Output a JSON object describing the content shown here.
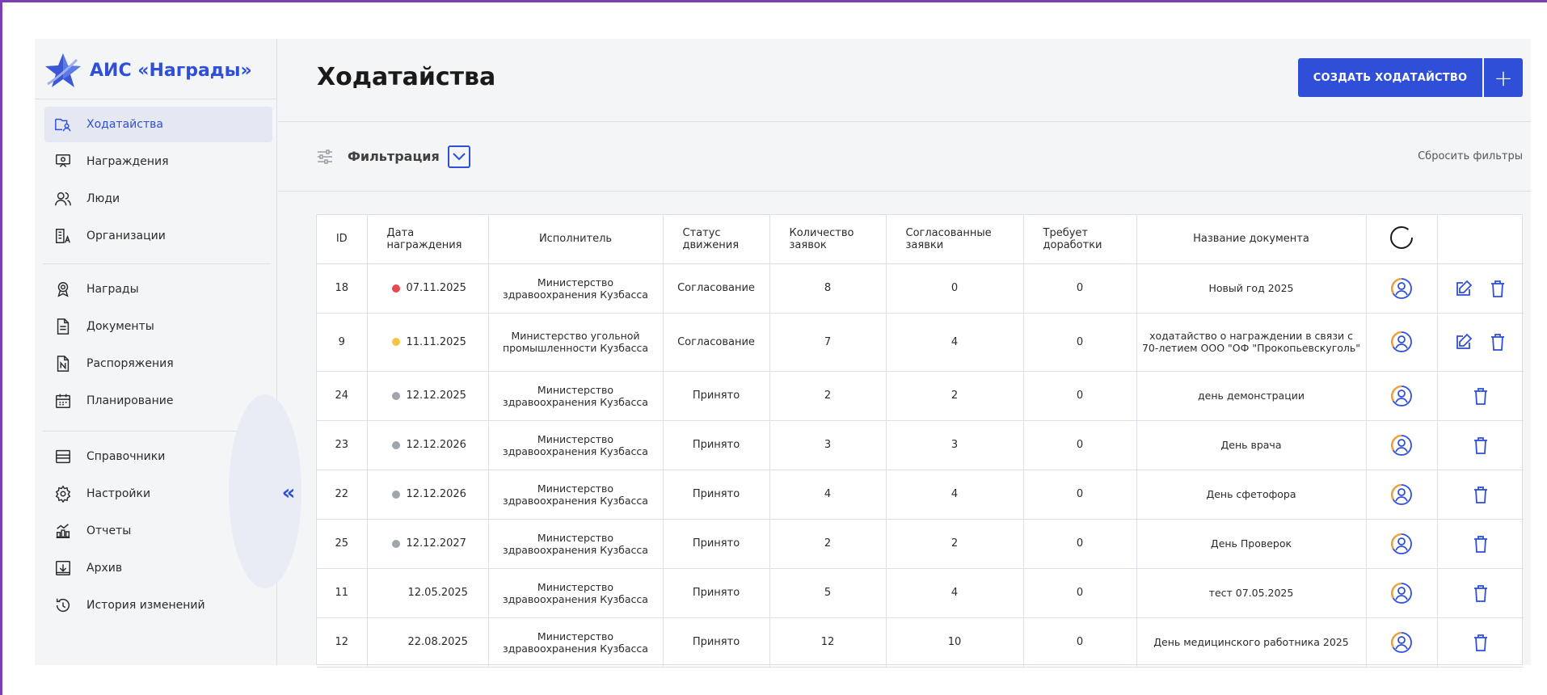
{
  "app": {
    "title": "АИС «Награды»"
  },
  "sidebar": {
    "items": [
      {
        "label": "Ходатайства",
        "icon": "folder-user-icon",
        "active": true
      },
      {
        "label": "Награждения",
        "icon": "presentation-icon"
      },
      {
        "label": "Люди",
        "icon": "users-icon"
      },
      {
        "label": "Организации",
        "icon": "organization-icon"
      },
      {
        "label": "Награды",
        "icon": "medal-icon"
      },
      {
        "label": "Документы",
        "icon": "document-icon"
      },
      {
        "label": "Распоряжения",
        "icon": "order-document-icon"
      },
      {
        "label": "Планирование",
        "icon": "calendar-icon"
      },
      {
        "label": "Справочники",
        "icon": "reference-icon"
      },
      {
        "label": "Настройки",
        "icon": "gear-icon"
      },
      {
        "label": "Отчеты",
        "icon": "reports-icon"
      },
      {
        "label": "Архив",
        "icon": "archive-icon"
      },
      {
        "label": "История изменений",
        "icon": "history-icon"
      }
    ],
    "collapse_label": "«"
  },
  "header": {
    "title": "Ходатайства",
    "create_label": "СОЗДАТЬ ХОДАТАЙСТВО",
    "plus_label": "+"
  },
  "filters": {
    "label": "Фильтрация",
    "reset_label": "Сбросить фильтры"
  },
  "colors": {
    "accent": "#2f4fd8",
    "status_red": "#e5484d",
    "status_yellow": "#f5c542",
    "status_gray": "#a0a4ab"
  },
  "table": {
    "headers": {
      "id": "ID",
      "date": "Дата награждения",
      "executor": "Исполнитель",
      "status": "Статус движения",
      "count": "Количество заявок",
      "agreed": "Согласованные заявки",
      "rework": "Требует доработки",
      "doc": "Название документа"
    },
    "rows": [
      {
        "id": "18",
        "dot": "red",
        "date": "07.11.2025",
        "executor": "Министерство здравоохранения Кузбасса",
        "status": "Согласование",
        "count": "8",
        "agreed": "0",
        "rework": "0",
        "doc": "Новый год 2025",
        "editable": true
      },
      {
        "id": "9",
        "dot": "yellow",
        "date": "11.11.2025",
        "executor": "Министерство угольной промышленности Кузбасса",
        "status": "Согласование",
        "count": "7",
        "agreed": "4",
        "rework": "0",
        "doc": "ходатайство о награждении в связи с 70-летием ООО \"ОФ \"Прокопьевскуголь\"",
        "editable": true
      },
      {
        "id": "24",
        "dot": "gray",
        "date": "12.12.2025",
        "executor": "Министерство здравоохранения Кузбасса",
        "status": "Принято",
        "count": "2",
        "agreed": "2",
        "rework": "0",
        "doc": "день демонстрации",
        "editable": false
      },
      {
        "id": "23",
        "dot": "gray",
        "date": "12.12.2026",
        "executor": "Министерство здравоохранения Кузбасса",
        "status": "Принято",
        "count": "3",
        "agreed": "3",
        "rework": "0",
        "doc": "День врача",
        "editable": false
      },
      {
        "id": "22",
        "dot": "gray",
        "date": "12.12.2026",
        "executor": "Министерство здравоохранения Кузбасса",
        "status": "Принято",
        "count": "4",
        "agreed": "4",
        "rework": "0",
        "doc": "День сфетофора",
        "editable": false
      },
      {
        "id": "25",
        "dot": "gray",
        "date": "12.12.2027",
        "executor": "Министерство здравоохранения Кузбасса",
        "status": "Принято",
        "count": "2",
        "agreed": "2",
        "rework": "0",
        "doc": "День Проверок",
        "editable": false
      },
      {
        "id": "11",
        "dot": "",
        "date": "12.05.2025",
        "executor": "Министерство здравоохранения Кузбасса",
        "status": "Принято",
        "count": "5",
        "agreed": "4",
        "rework": "0",
        "doc": "тест 07.05.2025",
        "editable": false
      },
      {
        "id": "12",
        "dot": "",
        "date": "22.08.2025",
        "executor": "Министерство здравоохранения Кузбасса",
        "status": "Принято",
        "count": "12",
        "agreed": "10",
        "rework": "0",
        "doc": "День медицинского работника 2025",
        "editable": false
      }
    ]
  }
}
